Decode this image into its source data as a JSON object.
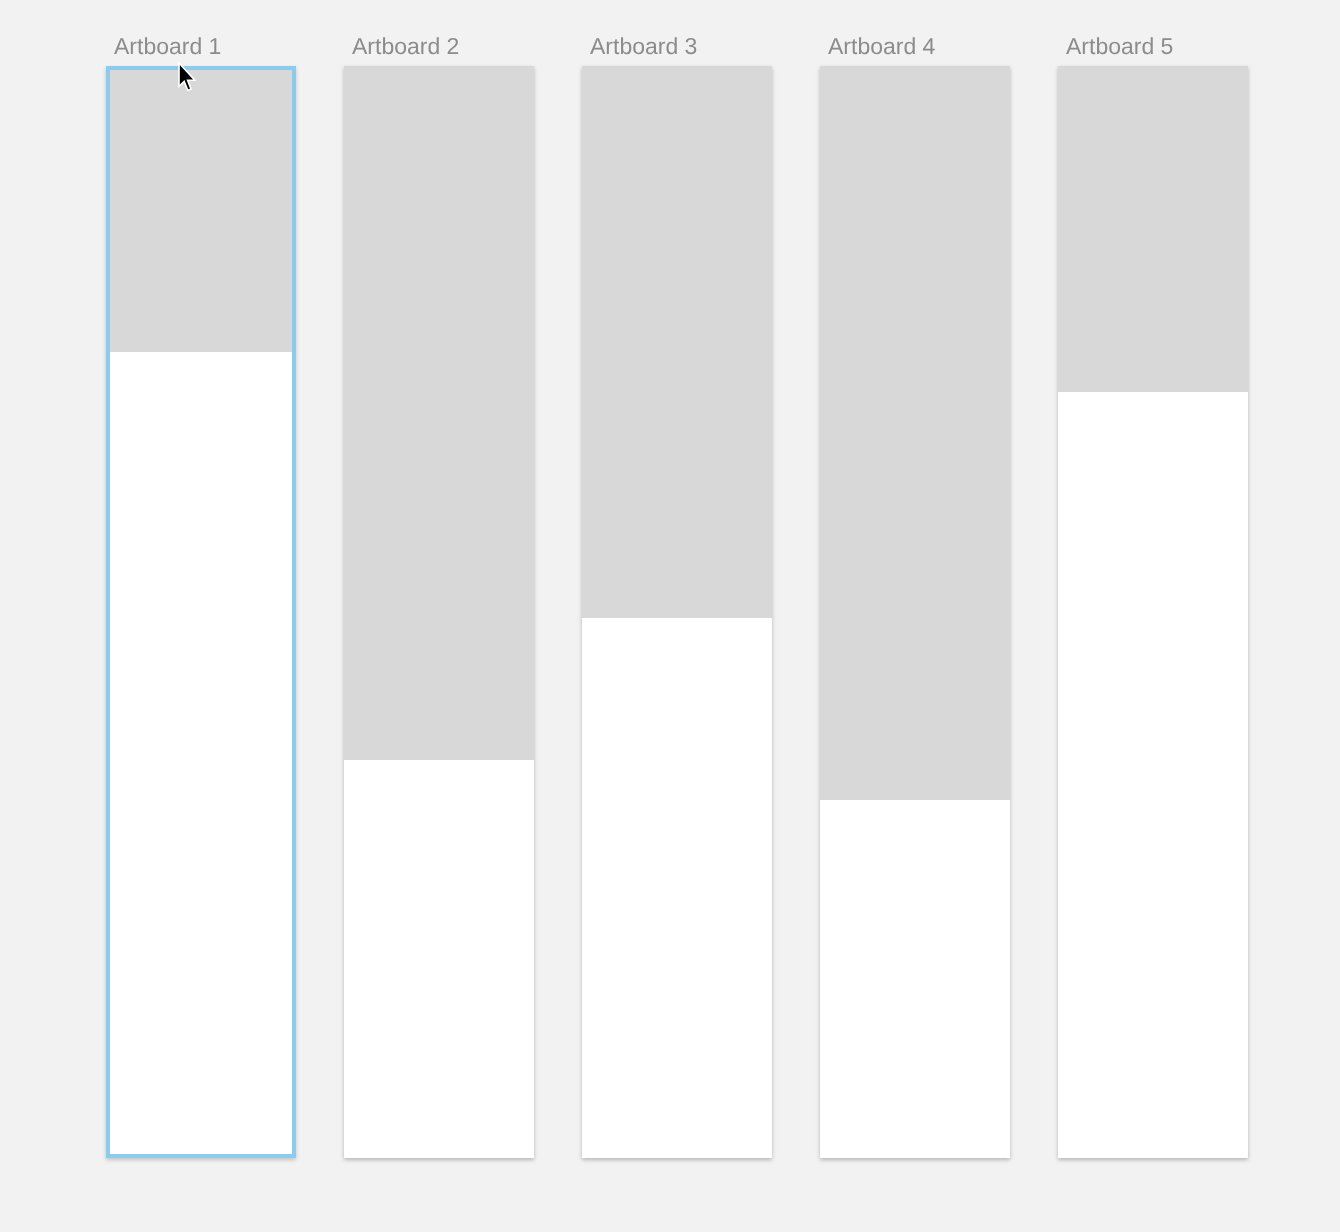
{
  "canvas": {
    "artboards": [
      {
        "title": "Artboard 1",
        "selected": true,
        "level": 0.26
      },
      {
        "title": "Artboard 2",
        "selected": false,
        "level": 0.635
      },
      {
        "title": "Artboard 3",
        "selected": false,
        "level": 0.506
      },
      {
        "title": "Artboard 4",
        "selected": false,
        "level": 0.673
      },
      {
        "title": "Artboard 5",
        "selected": false,
        "level": 0.299
      }
    ]
  }
}
